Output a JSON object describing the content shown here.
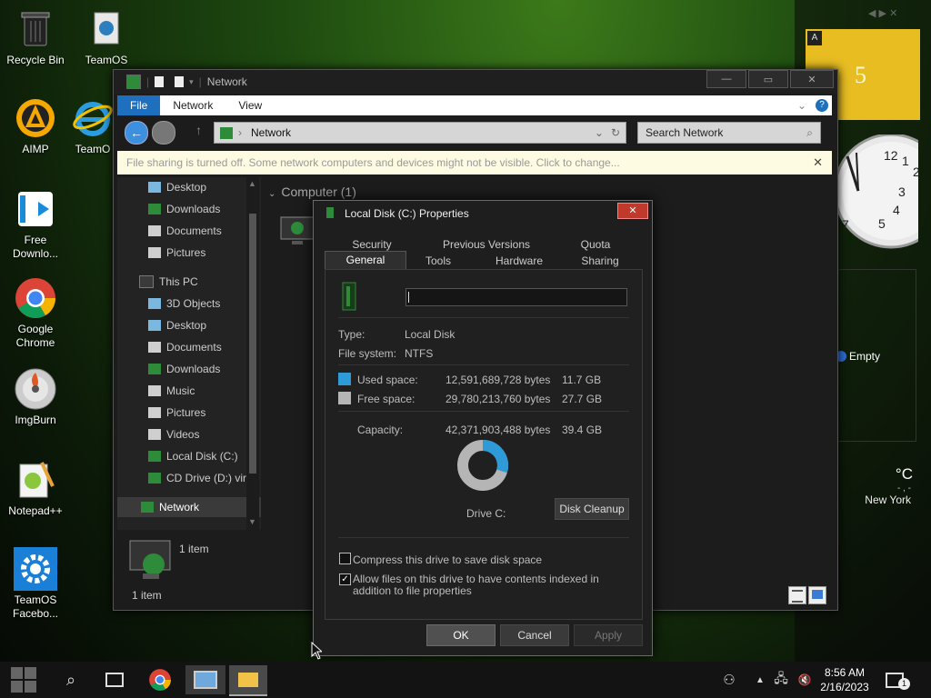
{
  "desktop": {
    "icons": [
      {
        "label": "Recycle Bin",
        "icon": "recycle-bin-icon"
      },
      {
        "label": "TeamOS",
        "icon": "document-icon"
      },
      {
        "label": "AIMP",
        "icon": "aimp-icon"
      },
      {
        "label": "TeamO",
        "icon": "internet-explorer-icon"
      },
      {
        "label": "Free Downlo...",
        "icon": "download-arrow-icon"
      },
      {
        "label": "Google Chrome",
        "icon": "chrome-icon"
      },
      {
        "label": "ImgBurn",
        "icon": "disc-icon"
      },
      {
        "label": "Notepad++",
        "icon": "notepad-icon"
      },
      {
        "label": "TeamOS Facebo...",
        "icon": "gear-icon"
      }
    ]
  },
  "widgets": {
    "calendar_letter": "A",
    "calendar_number": "5",
    "clock_numbers": [
      "12",
      "1",
      "2",
      "3",
      "4",
      "5",
      "7"
    ],
    "recycle_empty": "Empty",
    "weather_unit": "°C",
    "weather_dash": "- , -",
    "weather_city": "New York"
  },
  "explorer": {
    "title": "Network",
    "menu": {
      "file": "File",
      "network": "Network",
      "view": "View"
    },
    "address": "Network",
    "search_placeholder": "Search Network",
    "infobar": "File sharing is turned off. Some network computers and devices might not be visible. Click to change...",
    "nav_items": [
      {
        "label": "Desktop",
        "color": "#7ab8e0"
      },
      {
        "label": "Downloads",
        "color": "#2e8b3a"
      },
      {
        "label": "Documents",
        "color": "#cfcfcf"
      },
      {
        "label": "Pictures",
        "color": "#cfcfcf"
      },
      {
        "label": "This PC",
        "color": "#3a3a3a"
      },
      {
        "label": "3D Objects",
        "color": "#7ab8e0"
      },
      {
        "label": "Desktop",
        "color": "#7ab8e0"
      },
      {
        "label": "Documents",
        "color": "#cfcfcf"
      },
      {
        "label": "Downloads",
        "color": "#2e8b3a"
      },
      {
        "label": "Music",
        "color": "#cfcfcf"
      },
      {
        "label": "Pictures",
        "color": "#cfcfcf"
      },
      {
        "label": "Videos",
        "color": "#cfcfcf"
      },
      {
        "label": "Local Disk (C:)",
        "color": "#2e8b3a"
      },
      {
        "label": "CD Drive (D:) virt",
        "color": "#2e8b3a"
      },
      {
        "label": "Network",
        "color": "#2e8b3a"
      }
    ],
    "group_header": "Computer (1)",
    "details_count": "1 item",
    "status_count": "1 item"
  },
  "dialog": {
    "title": "Local Disk (C:) Properties",
    "tabs_row1": [
      "Security",
      "Previous Versions",
      "Quota"
    ],
    "tabs_row2": [
      "General",
      "Tools",
      "Hardware",
      "Sharing"
    ],
    "active_tab": "General",
    "name_value": "",
    "type_label": "Type:",
    "type_value": "Local Disk",
    "fs_label": "File system:",
    "fs_value": "NTFS",
    "used_label": "Used space:",
    "used_bytes": "12,591,689,728 bytes",
    "used_gb": "11.7 GB",
    "free_label": "Free space:",
    "free_bytes": "29,780,213,760 bytes",
    "free_gb": "27.7 GB",
    "capacity_label": "Capacity:",
    "capacity_bytes": "42,371,903,488 bytes",
    "capacity_gb": "39.4 GB",
    "used_fraction": 0.297,
    "used_color": "#2e9ad8",
    "free_color": "#b5b5b5",
    "drive_label": "Drive C:",
    "cleanup_button": "Disk Cleanup",
    "compress_label": "Compress this drive to save disk space",
    "compress_checked": false,
    "index_label": "Allow files on this drive to have contents indexed in addition to file properties",
    "index_checked": true,
    "ok": "OK",
    "cancel": "Cancel",
    "apply": "Apply"
  },
  "taskbar": {
    "time": "8:56 AM",
    "date": "2/16/2023",
    "notification_count": "1"
  }
}
